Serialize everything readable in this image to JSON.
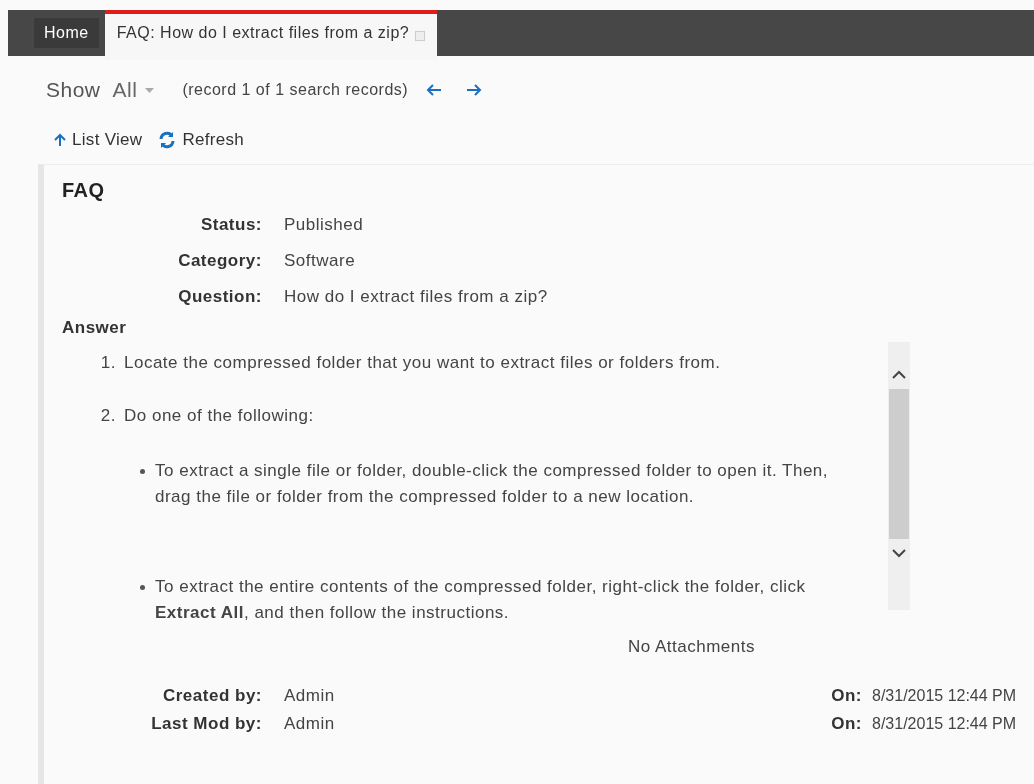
{
  "tabs": [
    {
      "label": "Home",
      "selected": false
    },
    {
      "label": "FAQ: How do I extract files from a zip?",
      "selected": true,
      "closable": true
    }
  ],
  "filter": {
    "label": "Show",
    "value": "All",
    "record_info": "(record 1 of 1 search records)"
  },
  "toolbar": [
    {
      "kind": "list",
      "label": "List View"
    },
    {
      "kind": "refresh",
      "label": "Refresh"
    }
  ],
  "record": {
    "title": "FAQ",
    "fields": [
      {
        "label": "Status:",
        "value": "Published"
      },
      {
        "label": "Category:",
        "value": "Software"
      },
      {
        "label": "Question:",
        "value": "How do I extract files from a zip?"
      }
    ],
    "answer_label": "Answer",
    "steps": [
      {
        "number": "1.",
        "text": "Locate the compressed folder that you want to extract files or folders from."
      },
      {
        "number": "2.",
        "text": "Do one of the following:",
        "bullets": [
          "To extract a single file or folder, double-click the compressed folder to open it. Then, drag the file or folder from the compressed folder to a new location.",
          "To extract the entire contents of the compressed folder, right-click the folder, click **Extract All**, and then follow the instructions."
        ]
      }
    ],
    "attachments": "No Attachments",
    "audit": [
      {
        "label": "Created by:",
        "value": "Admin",
        "on_label": "On:",
        "on_value": "8/31/2015 12:44 PM"
      },
      {
        "label": "Last Mod by:",
        "value": "Admin",
        "on_label": "On:",
        "on_value": "8/31/2015 12:44 PM"
      }
    ]
  }
}
